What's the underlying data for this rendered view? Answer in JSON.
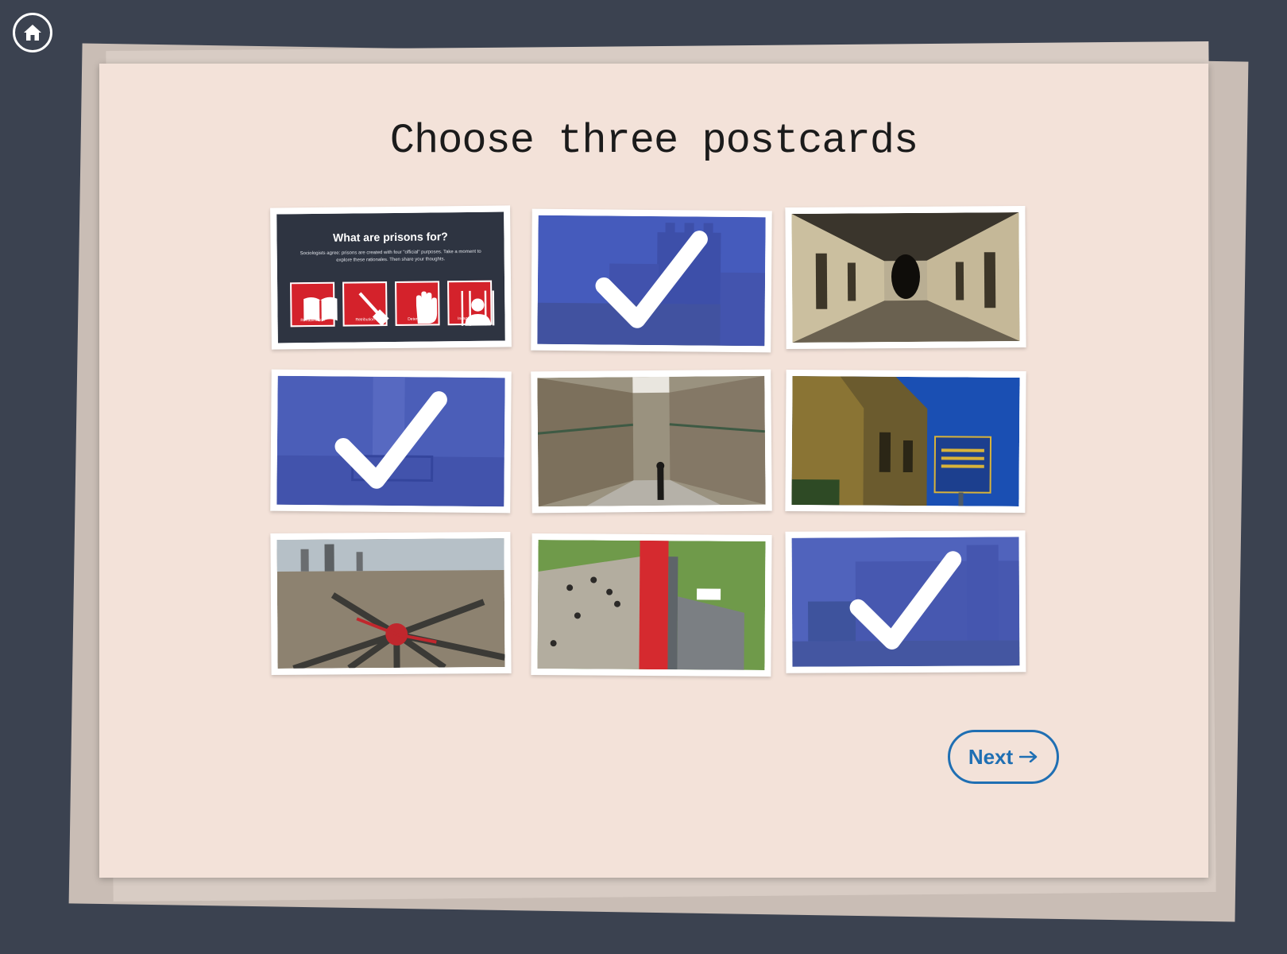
{
  "page": {
    "title": "Choose three postcards"
  },
  "home": {
    "icon": "home-icon"
  },
  "postcards": [
    {
      "id": "prisons-purposes",
      "selected": false,
      "title": "What are prisons for?",
      "subtitle": "Sociologists agree: prisons are created with four \"official\" purposes. Take a moment to explore these rationales. Then share your thoughts.",
      "icons": [
        {
          "icon": "book-icon",
          "label": "Rehabilitation"
        },
        {
          "icon": "hammer-icon",
          "label": "Retribution"
        },
        {
          "icon": "hand-icon",
          "label": "Deterrence"
        },
        {
          "icon": "prisoner-icon",
          "label": "Incapacitation"
        }
      ]
    },
    {
      "id": "prison-tower",
      "selected": true
    },
    {
      "id": "cellblock-corridor",
      "selected": false
    },
    {
      "id": "cell-interior",
      "selected": true
    },
    {
      "id": "two-tier-cellblock",
      "selected": false
    },
    {
      "id": "facade-historic-marker",
      "selected": false
    },
    {
      "id": "aerial-radial-plan",
      "selected": false
    },
    {
      "id": "visitors-monument",
      "selected": false
    },
    {
      "id": "prison-wall-exterior",
      "selected": true
    }
  ],
  "next": {
    "label": "Next",
    "icon": "arrow-right-icon"
  },
  "colors": {
    "accent": "#1f6fb3",
    "selection_overlay": "#374bbe",
    "background": "#3b4250",
    "card": "#f3e2d9"
  }
}
